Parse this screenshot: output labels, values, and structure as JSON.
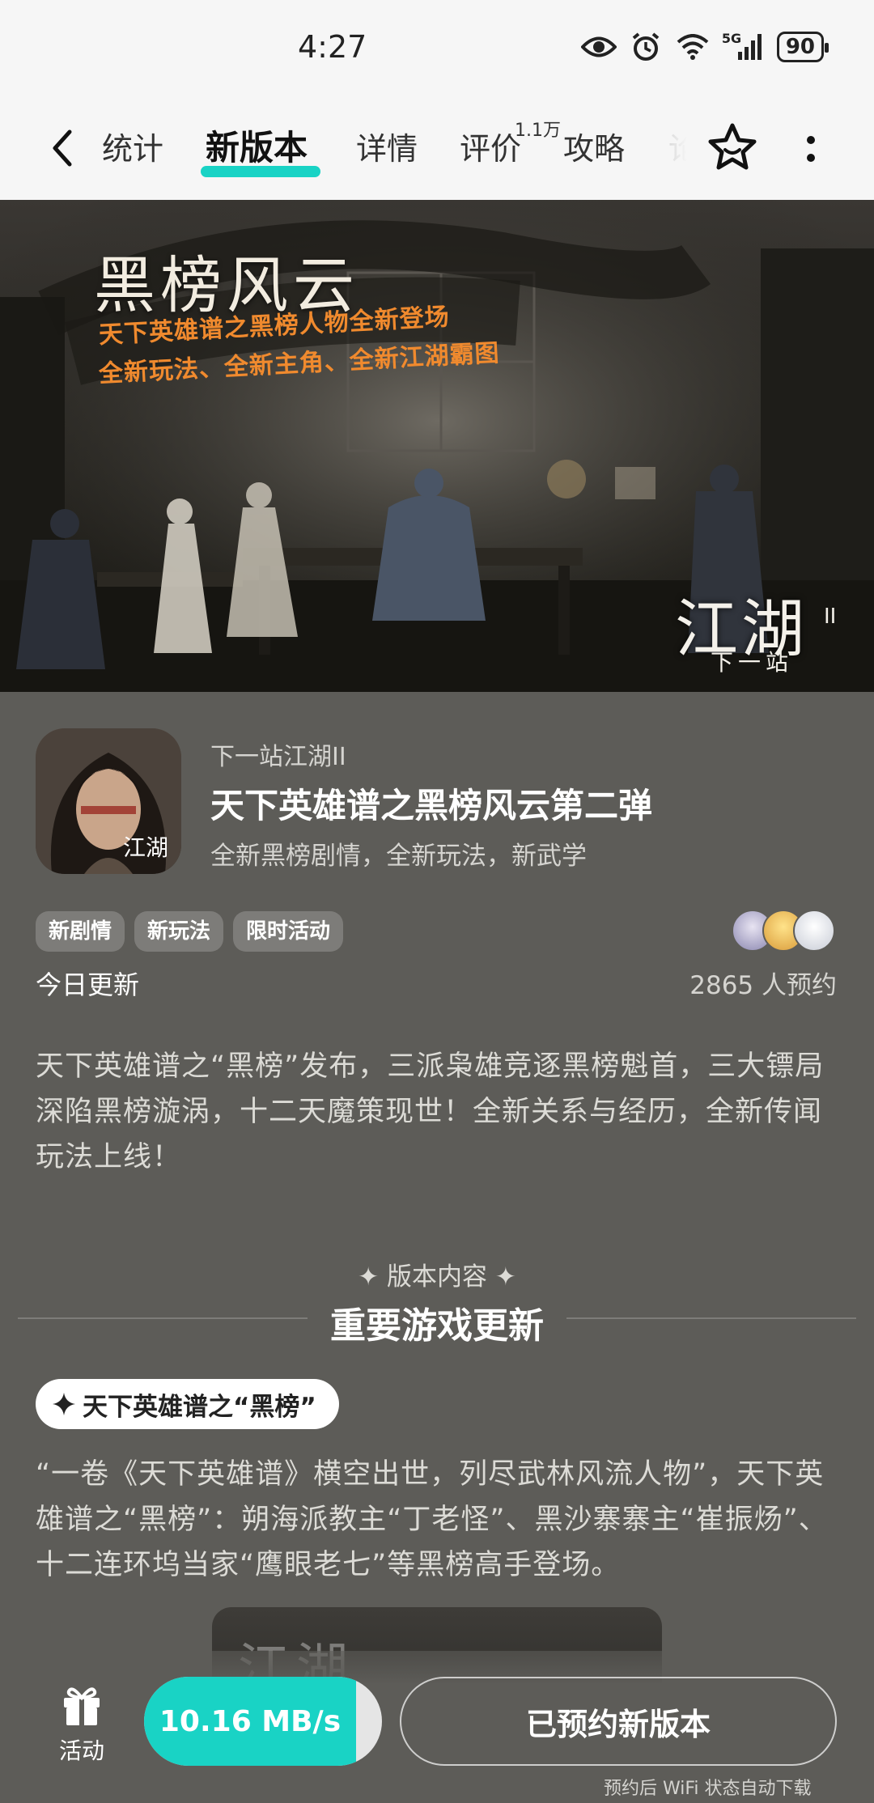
{
  "status_bar": {
    "time": "4:27",
    "network": "5G",
    "battery": "90"
  },
  "nav": {
    "tabs": [
      {
        "label": "统计"
      },
      {
        "label": "新版本"
      },
      {
        "label": "详情"
      },
      {
        "label": "评价"
      },
      {
        "label": "攻略"
      },
      {
        "label": "论"
      }
    ],
    "review_badge": "1.1万",
    "active_tab": "新版本"
  },
  "banner": {
    "title": "黑榜风云",
    "subtitle_line1": "天下英雄谱之黑榜人物全新登场",
    "subtitle_line2": "全新玩法、全新主角、全新江湖霸图",
    "logo": "江湖",
    "logo_sub": "下一站",
    "logo_num": "II"
  },
  "app": {
    "name": "下一站江湖II",
    "update_title": "天下英雄谱之黑榜风云第二弹",
    "update_desc": "全新黑榜剧情，全新玩法，新武学",
    "icon_text": "江湖"
  },
  "tags": [
    "新剧情",
    "新玩法",
    "限时活动"
  ],
  "update_date": "今日更新",
  "reserve_count": "2865 人预约",
  "intro": "天下英雄谱之“黑榜”发布，三派枭雄竞逐黑榜魁首，三大镖局深陷黑榜漩涡，十二天魔策现世！全新关系与经历，全新传闻玩法上线！",
  "section": {
    "kicker": "✦ 版本内容 ✦",
    "title": "重要游戏更新"
  },
  "feature": {
    "pill_label": "天下英雄谱之“黑榜”",
    "body": "“一卷《天下英雄谱》横空出世，列尽武林风流人物”，天下英雄谱之“黑榜”：朔海派教主“丁老怪”、黑沙寨寨主“崔振炀”、十二连环坞当家“鹰眼老七”等黑榜高手登场。",
    "preview_text": "江湖"
  },
  "bottom_bar": {
    "activity_label": "活动",
    "download_speed": "10.16 MB/s",
    "download_progress": 0.89,
    "reserved_label": "已预约新版本",
    "wifi_note": "预约后 WiFi 状态自动下载"
  },
  "colors": {
    "accent": "#19d3c5",
    "page_bg": "#5d5c58",
    "banner_sub": "#f08a2e"
  }
}
